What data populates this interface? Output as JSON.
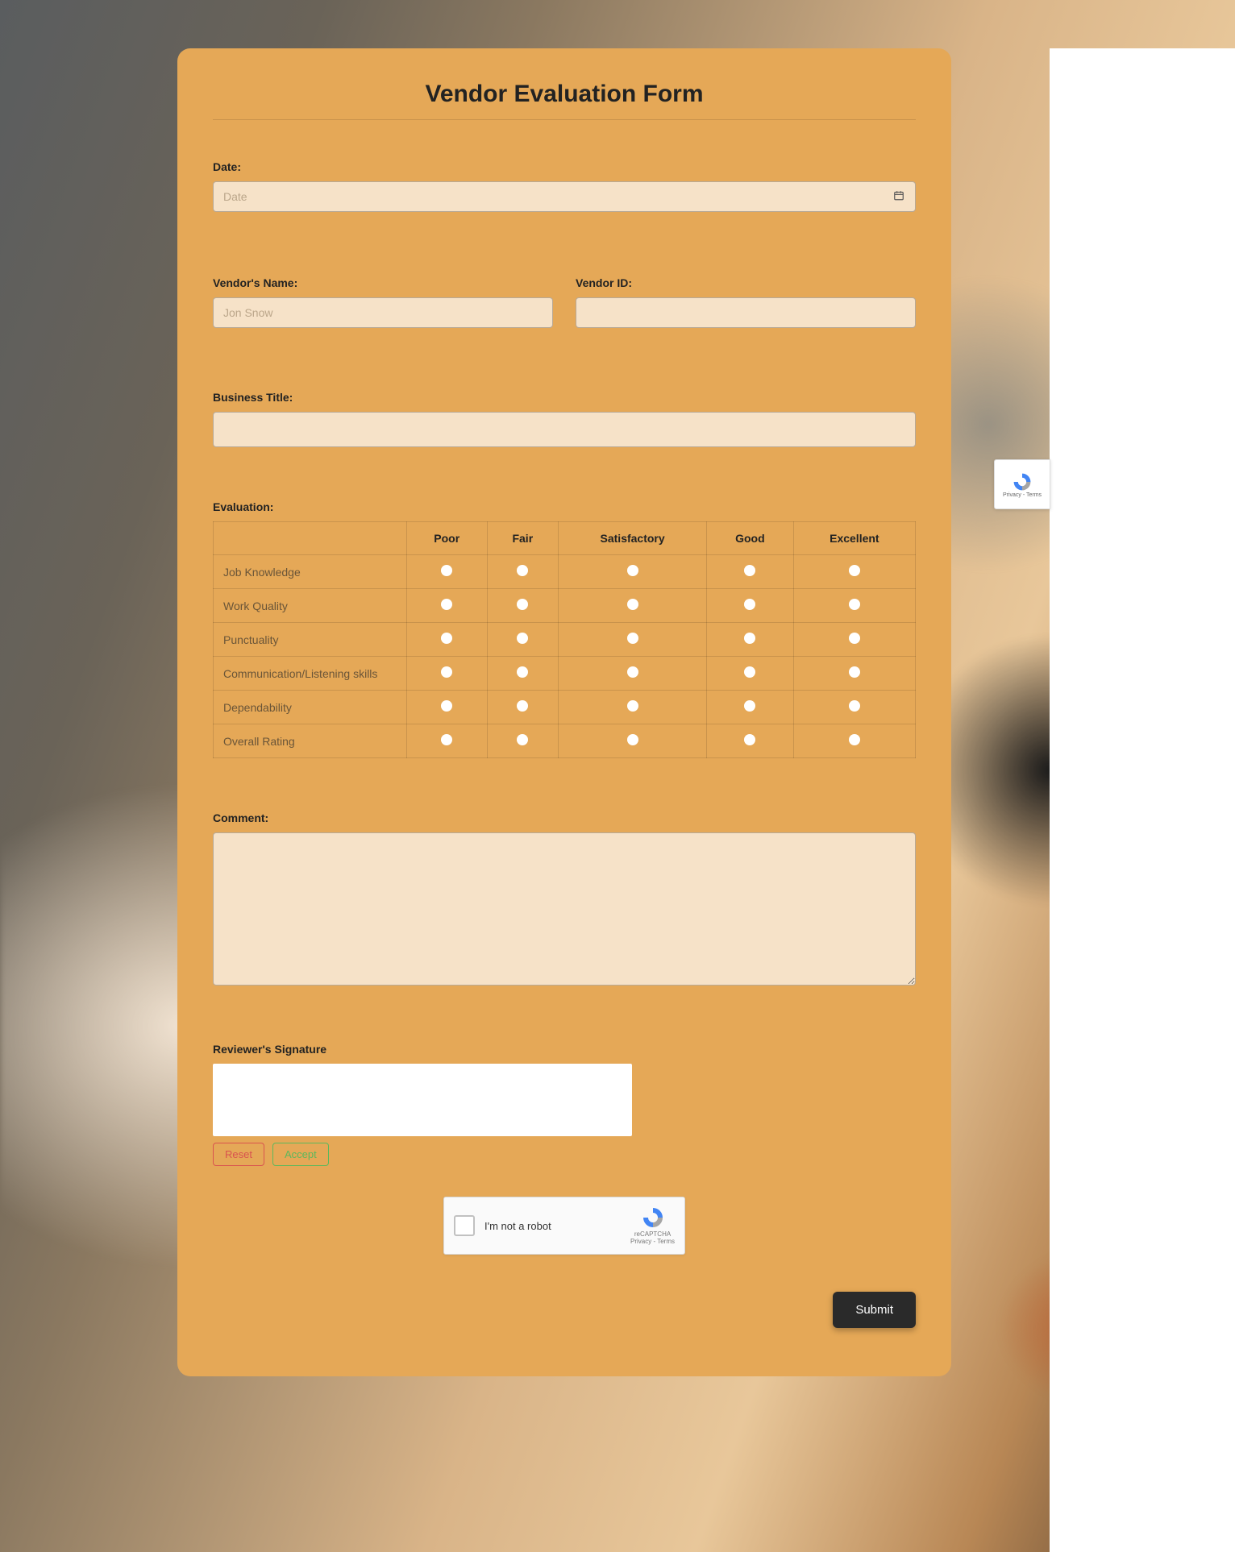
{
  "form": {
    "title": "Vendor Evaluation Form",
    "date_label": "Date:",
    "date_placeholder": "Date",
    "vendor_name_label": "Vendor's Name:",
    "vendor_name_placeholder": "Jon Snow",
    "vendor_id_label": "Vendor ID:",
    "business_title_label": "Business Title:",
    "evaluation_label": "Evaluation:",
    "columns": [
      "Poor",
      "Fair",
      "Satisfactory",
      "Good",
      "Excellent"
    ],
    "rows": [
      "Job Knowledge",
      "Work Quality",
      "Punctuality",
      "Communication/Listening skills",
      "Dependability",
      "Overall Rating"
    ],
    "comment_label": "Comment:",
    "signature_label": "Reviewer's Signature",
    "reset_label": "Reset",
    "accept_label": "Accept",
    "captcha_text": "I'm not a robot",
    "captcha_brand": "reCAPTCHA",
    "captcha_terms": "Privacy - Terms",
    "submit_label": "Submit"
  }
}
